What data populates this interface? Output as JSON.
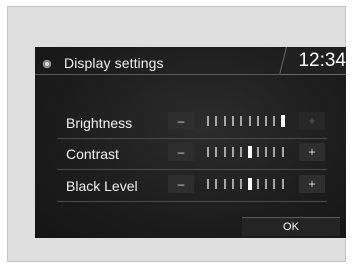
{
  "header": {
    "title": "Display settings",
    "time": "12:34",
    "icon": "display-icon"
  },
  "settings": [
    {
      "label": "Brightness",
      "minus": "–",
      "plus": "+",
      "level": 1.0,
      "tick_count": 10,
      "plus_enabled": false
    },
    {
      "label": "Contrast",
      "minus": "–",
      "plus": "+",
      "level": 0.5,
      "tick_count": 10,
      "plus_enabled": true
    },
    {
      "label": "Black Level",
      "minus": "–",
      "plus": "+",
      "level": 0.5,
      "tick_count": 10,
      "plus_enabled": true
    }
  ],
  "ok_label": "OK",
  "colors": {
    "screen_bg": "#1f1f1f",
    "frame_bg": "#dedede",
    "text": "#f2f2f2"
  }
}
